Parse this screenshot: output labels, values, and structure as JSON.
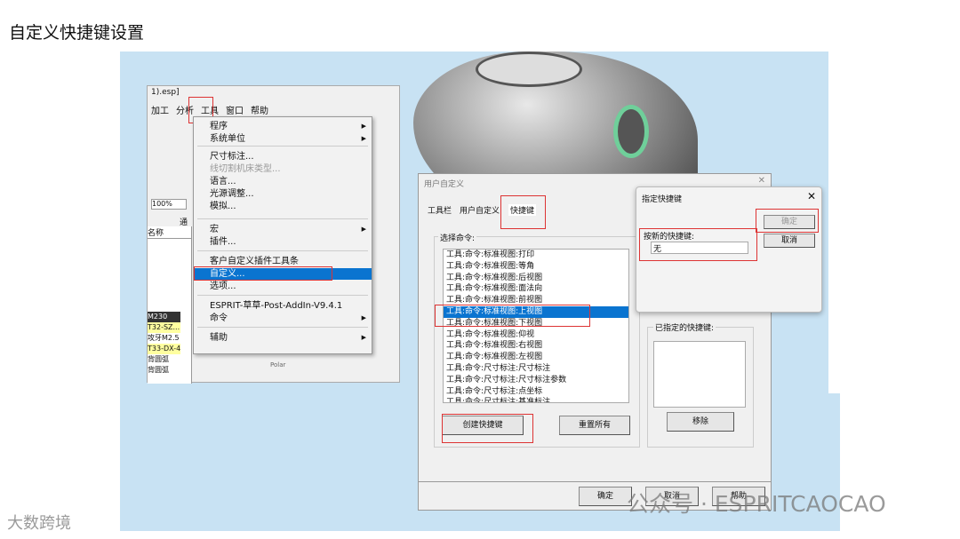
{
  "page": {
    "title": "自定义快捷键设置"
  },
  "app": {
    "title_fragment": "1).esp]",
    "menubar": [
      "加工",
      "分析",
      "工具",
      "窗口",
      "帮助"
    ],
    "zoom": "100%",
    "panel_header": "名称",
    "panel_col": "通",
    "tools": [
      "M230",
      "T32-SZ...",
      "攻牙M2.5",
      "T33-DX-4",
      "背圆弧",
      "背圆弧"
    ],
    "polar": "Polar"
  },
  "tools_menu": {
    "items": [
      {
        "label": "程序",
        "submenu": true
      },
      {
        "label": "系统单位",
        "submenu": true
      },
      {
        "label": "尺寸标注..."
      },
      {
        "label": "线切割机床类型...",
        "disabled": true
      },
      {
        "label": "语言..."
      },
      {
        "label": "光源调整..."
      },
      {
        "label": "模拟..."
      },
      {
        "label": "宏",
        "submenu": true
      },
      {
        "label": "插件..."
      },
      {
        "label": "客户自定义插件工具条"
      },
      {
        "label": "自定义...",
        "selected": true
      },
      {
        "label": "选项..."
      },
      {
        "label": "ESPRIT-草草-Post-AddIn-V9.4.1"
      },
      {
        "label": "命令",
        "submenu": true
      },
      {
        "label": "辅助",
        "submenu": true
      }
    ]
  },
  "customize_dialog": {
    "title": "用户自定义",
    "close": "✕",
    "tabs": [
      "工具栏",
      "用户自定义",
      "快捷键"
    ],
    "active_tab": "快捷键",
    "select_command_label": "选择命令:",
    "commands": [
      "工具:命令:标准视图:打印",
      "工具:命令:标准视图:等角",
      "工具:命令:标准视图:后视图",
      "工具:命令:标准视图:面法向",
      "工具:命令:标准视图:前视图",
      "工具:命令:标准视图:上视图",
      "工具:命令:标准视图:下视图",
      "工具:命令:标准视图:仰视",
      "工具:命令:标准视图:右视图",
      "工具:命令:标准视图:左视图",
      "工具:命令:尺寸标注:尺寸标注",
      "工具:命令:尺寸标注:尺寸标注参数",
      "工具:命令:尺寸标注:点坐标",
      "工具:命令:尺寸标注:基准标注"
    ],
    "selected_command": "工具:命令:标准视图:上视图",
    "assigned_label": "已指定的快捷键:",
    "create_button": "创建快捷键",
    "reset_button": "重置所有",
    "remove_button": "移除",
    "ok": "确定",
    "cancel": "取消",
    "help": "帮助"
  },
  "assign_dialog": {
    "title": "指定快捷键",
    "close": "✕",
    "new_key_label": "按新的快捷键:",
    "new_key_value": "无",
    "ok": "确定",
    "cancel": "取消"
  },
  "watermarks": {
    "left": "大数跨境",
    "right": "公众号 · ESPRITCAOCAO"
  },
  "colors": {
    "highlight": "#0a74d0",
    "annotation": "#dd3333",
    "background": "#c8e2f3"
  }
}
